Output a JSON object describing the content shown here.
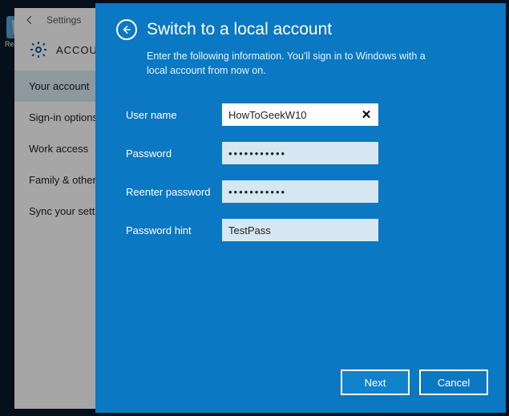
{
  "desktop": {
    "recycle_label": "Recycle"
  },
  "settings": {
    "app_label": "Settings",
    "header_title": "ACCOUNTS",
    "items": [
      {
        "label": "Your account",
        "active": true
      },
      {
        "label": "Sign-in options",
        "active": false
      },
      {
        "label": "Work access",
        "active": false
      },
      {
        "label": "Family & other users",
        "active": false
      },
      {
        "label": "Sync your settings",
        "active": false
      }
    ]
  },
  "modal": {
    "title": "Switch to a local account",
    "subtitle": "Enter the following information. You'll sign in to Windows with a local account from now on.",
    "fields": {
      "username_label": "User name",
      "username_value": "HowToGeekW10",
      "password_label": "Password",
      "password_value": "•••••••••••",
      "reenter_label": "Reenter password",
      "reenter_value": "•••••••••••",
      "hint_label": "Password hint",
      "hint_value": "TestPass"
    },
    "buttons": {
      "next": "Next",
      "cancel": "Cancel"
    }
  }
}
